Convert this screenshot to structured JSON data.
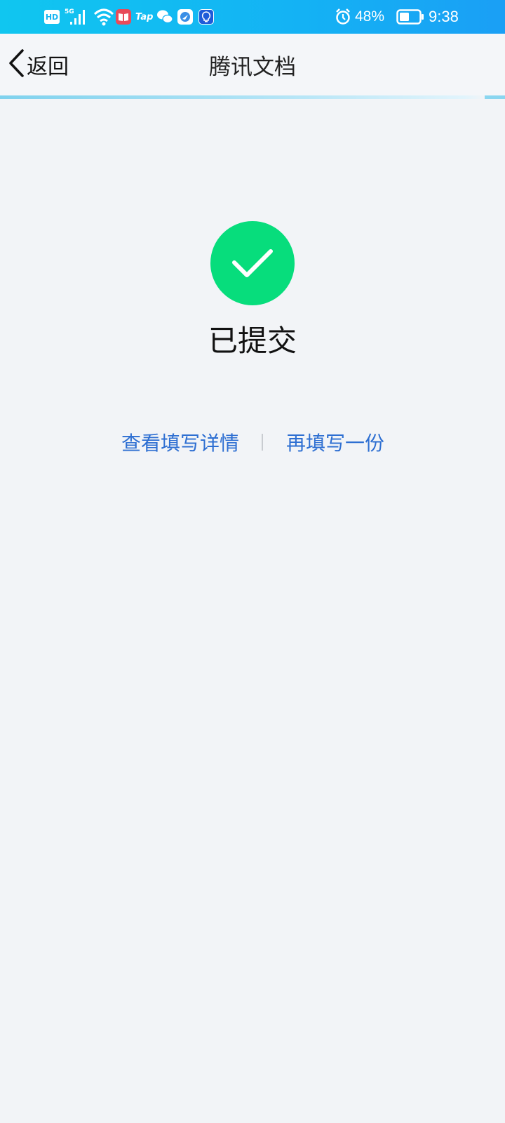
{
  "status_bar": {
    "hd_badge": "HD",
    "network_type": "5G",
    "tap_label": "Tap",
    "battery_percent": "48%",
    "time": "9:38",
    "icons": [
      "hd-icon",
      "signal-icon",
      "wifi-icon",
      "book-app-icon",
      "taptap-icon",
      "wechat-icon",
      "browser-app-icon",
      "bulb-app-icon",
      "alarm-icon",
      "battery-icon"
    ]
  },
  "nav": {
    "back_label": "返回",
    "title": "腾讯文档"
  },
  "content": {
    "status_text": "已提交",
    "actions": {
      "view_details": "查看填写详情",
      "fill_again": "再填写一份"
    }
  },
  "colors": {
    "status_bar": "#14b2f4",
    "success": "#07dd7c",
    "link": "#2e6fd2",
    "background": "#f2f4f7"
  }
}
